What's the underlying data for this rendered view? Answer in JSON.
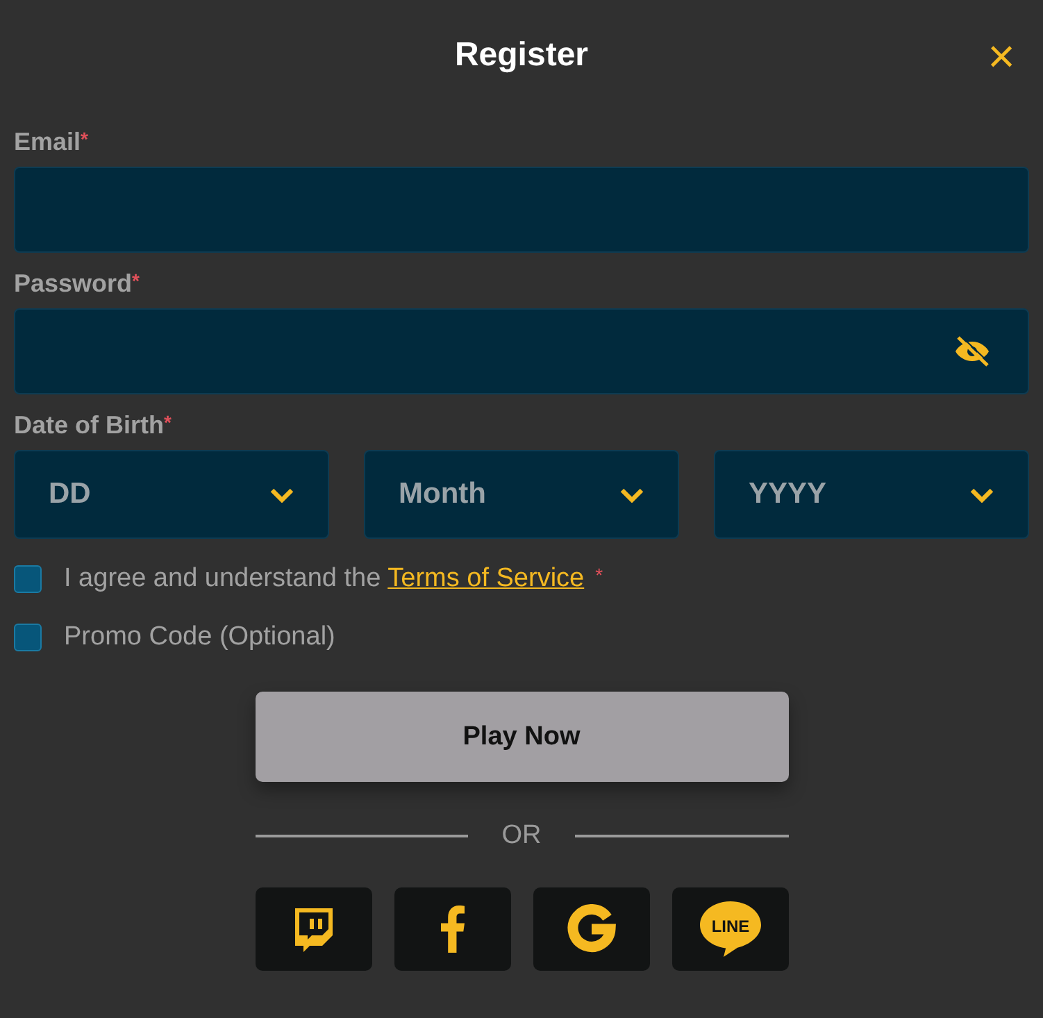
{
  "dialog": {
    "title": "Register",
    "close": "×"
  },
  "email": {
    "label": "Email",
    "required_mark": "*"
  },
  "password": {
    "label": "Password",
    "required_mark": "*",
    "visible": false
  },
  "date_of_birth": {
    "label": "Date of Birth",
    "required_mark": "*",
    "selects": [
      {
        "placeholder": "DD"
      },
      {
        "placeholder": "Month"
      },
      {
        "placeholder": "YYYY"
      }
    ]
  },
  "checkboxes": [
    {
      "text": "I agree and understand the ",
      "link": "Terms of Service",
      "required_mark": "*",
      "checked": false
    },
    {
      "text": "Promo Code (Optional)",
      "checked": false
    }
  ],
  "submit": {
    "label": "Play Now"
  },
  "divider": "OR",
  "social": [
    {
      "kind": "twitch"
    },
    {
      "kind": "facebook"
    },
    {
      "kind": "google"
    },
    {
      "kind": "line",
      "label": "LINE"
    }
  ]
}
